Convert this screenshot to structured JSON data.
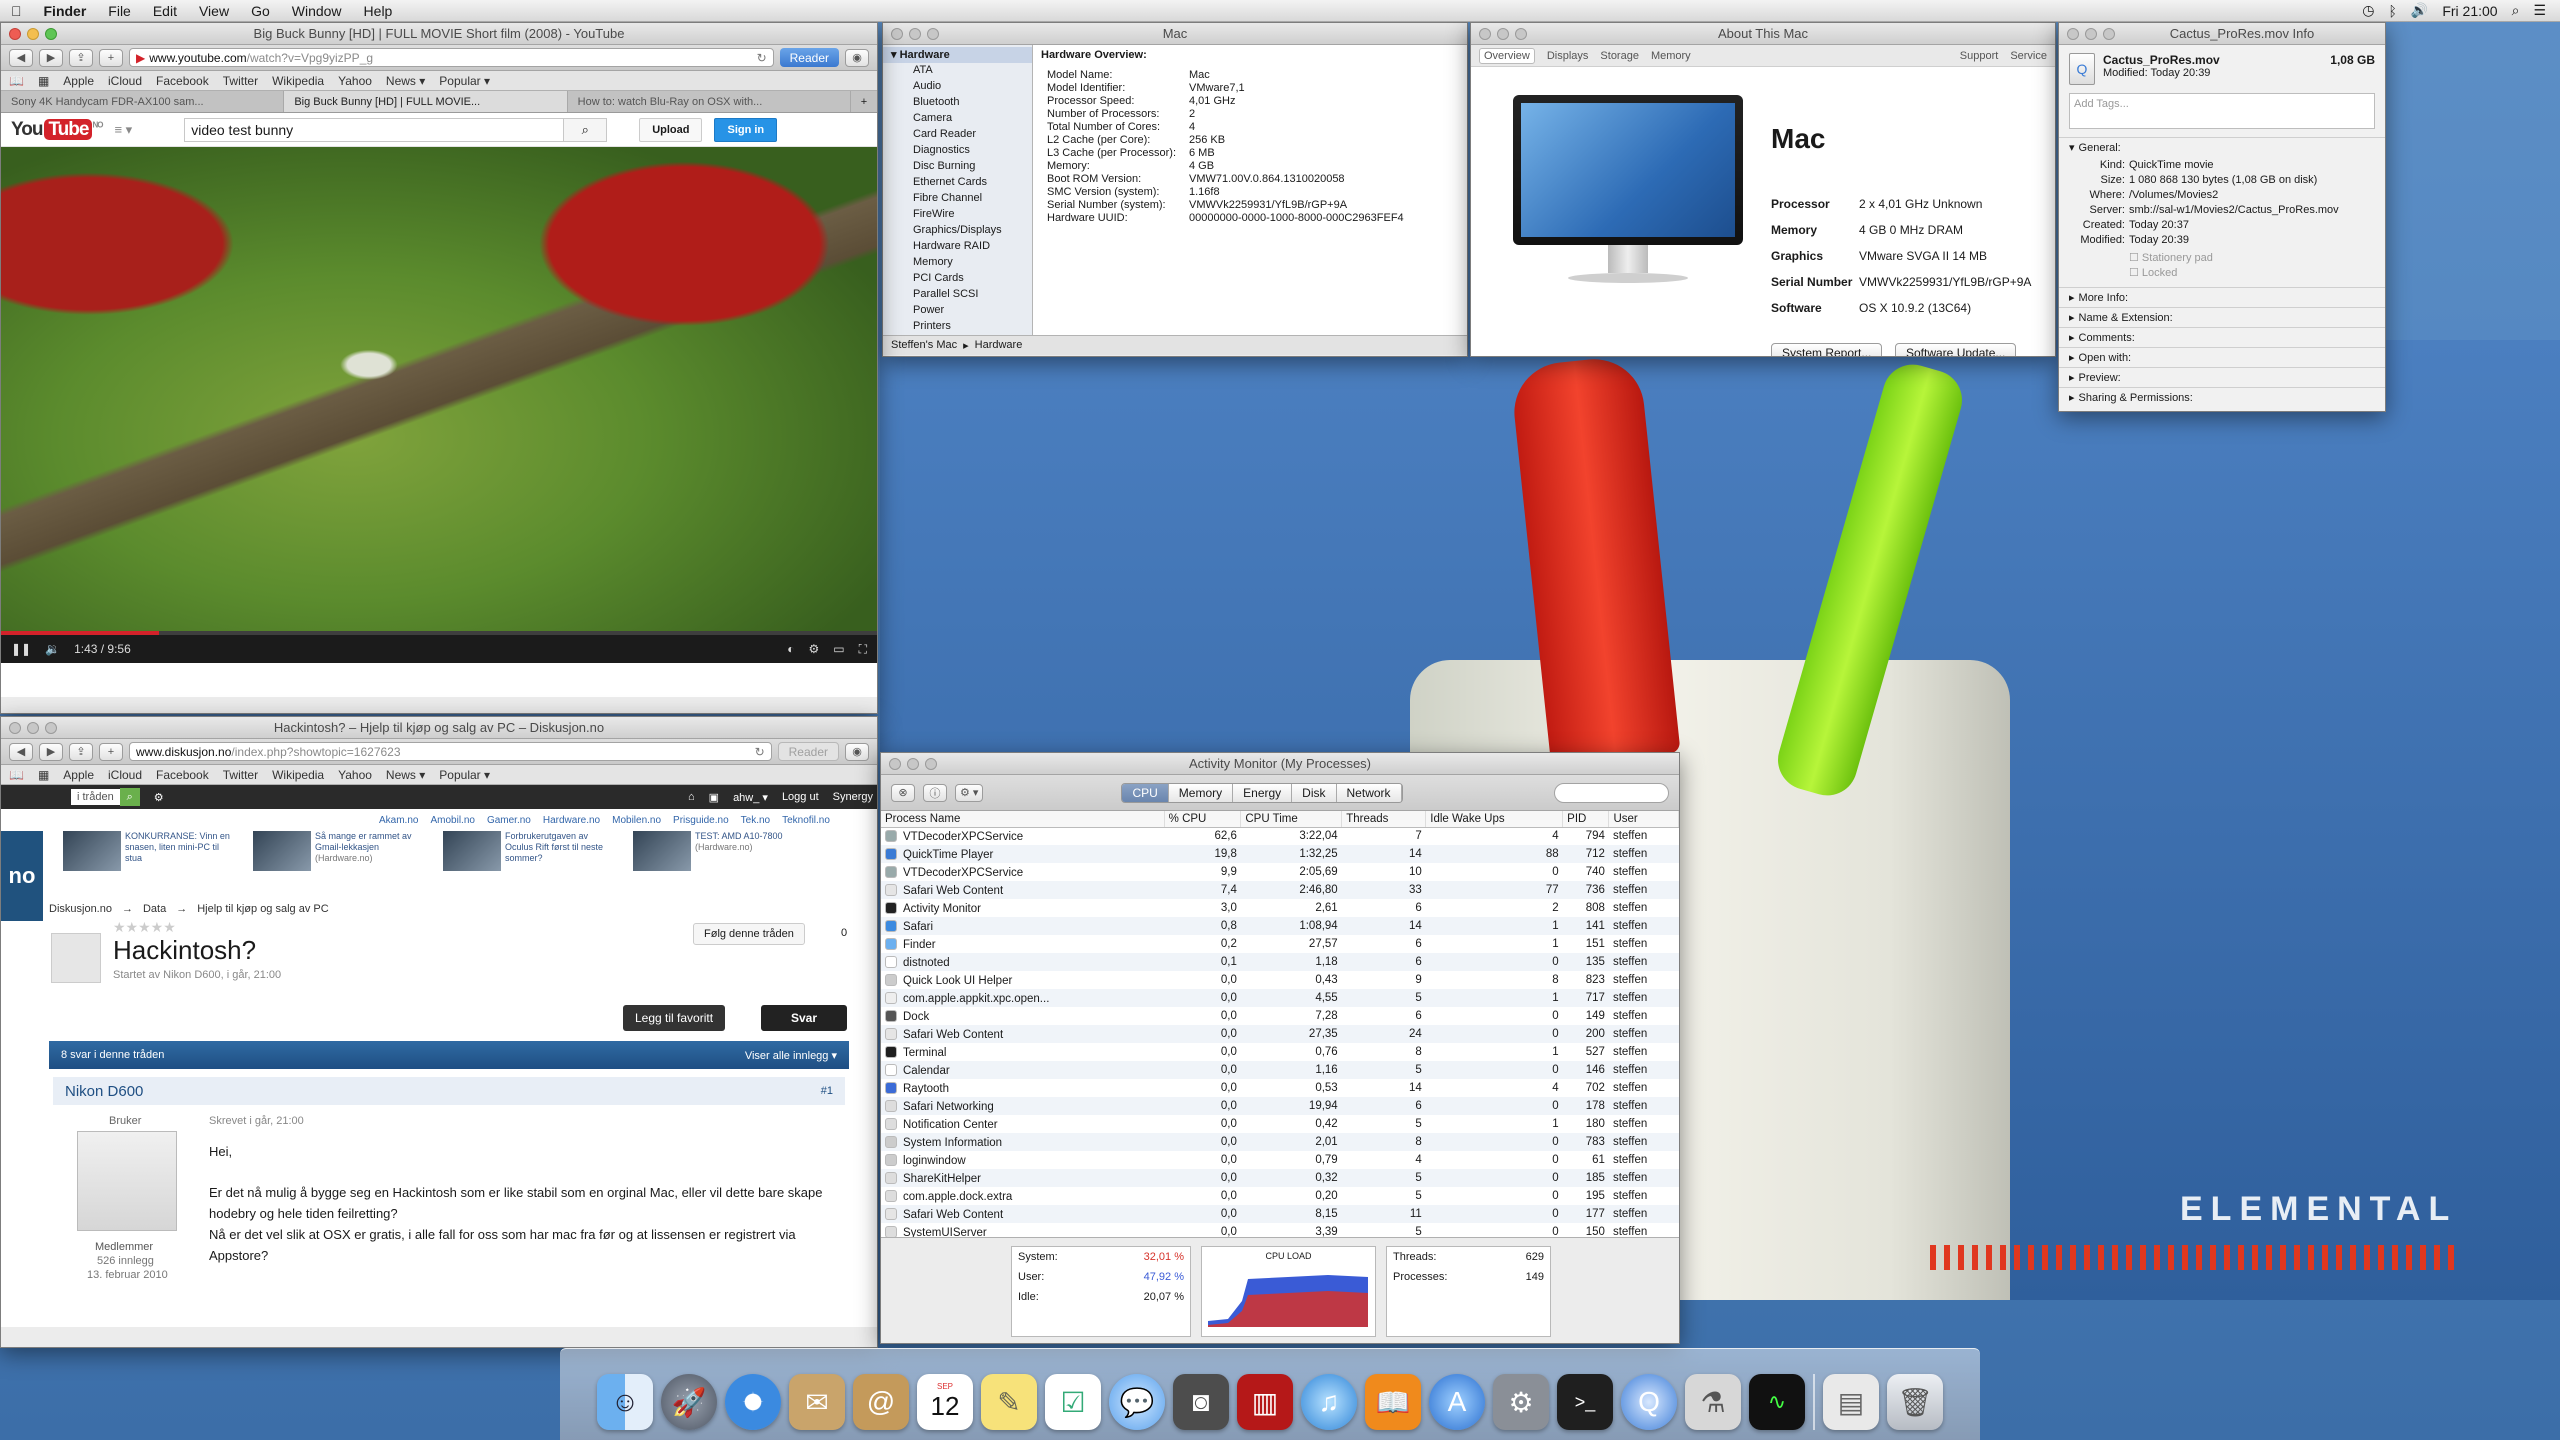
{
  "menubar": {
    "apple": "",
    "app": "Finder",
    "items": [
      "File",
      "Edit",
      "View",
      "Go",
      "Window",
      "Help"
    ],
    "clock": "Fri 21:00"
  },
  "youtube_window": {
    "title": "Big Buck Bunny [HD] | FULL MOVIE Short film (2008) - YouTube",
    "url_host": "www.youtube.com",
    "url_path": "/watch?v=Vpg9yizPP_g",
    "reader": "Reader",
    "bookmarks": [
      "Apple",
      "iCloud",
      "Facebook",
      "Twitter",
      "Wikipedia",
      "Yahoo",
      "News ▾",
      "Popular ▾"
    ],
    "tabs": [
      "Sony 4K Handycam FDR-AX100 sam...",
      "Big Buck Bunny [HD] | FULL MOVIE...",
      "How to: watch Blu-Ray on OSX with..."
    ],
    "logo": "You",
    "logo_tube": "Tube",
    "logo_locale": "NO",
    "search_value": "video test bunny",
    "upload": "Upload",
    "signin": "Sign in",
    "time": "1:43 / 9:56",
    "progress": 0.18
  },
  "diskusjon_window": {
    "title": "Hackintosh? – Hjelp til kjøp og salg av PC – Diskusjon.no",
    "url_host": "www.diskusjon.no",
    "url_path": "/index.php?showtopic=1627623",
    "reader": "Reader",
    "bookmarks": [
      "Apple",
      "iCloud",
      "Facebook",
      "Twitter",
      "Wikipedia",
      "Yahoo",
      "News ▾",
      "Popular ▾"
    ],
    "search_scope": "i tråden",
    "user": "ahw_ ▾",
    "logout": "Logg ut",
    "synergy": "Synergy",
    "sites": [
      "Akam.no",
      "Amobil.no",
      "Gamer.no",
      "Hardware.no",
      "Mobilen.no",
      "Prisguide.no",
      "Tek.no",
      "Teknofil.no"
    ],
    "promos": [
      {
        "text": "KONKURRANSE: Vinn en snasen, liten mini-PC til stua"
      },
      {
        "text": "Så mange er rammet av Gmail-lekkasjen",
        "src": "(Hardware.no)"
      },
      {
        "text": "Forbrukerutgaven av Oculus Rift først til neste sommer?"
      },
      {
        "text": "TEST: AMD A10-7800",
        "src": "(Hardware.no)"
      }
    ],
    "breadcrumb": [
      "Diskusjon.no",
      "→",
      "Data",
      "→",
      "Hjelp til kjøp og salg av PC"
    ],
    "side_tab": "no",
    "follow": "Følg denne tråden",
    "follow_count": "0",
    "thread_title": "Hackintosh?",
    "thread_sub": "Startet av Nikon D600, i går, 21:00",
    "fav": "Legg til favoritt",
    "reply": "Svar",
    "answers": "8 svar i denne tråden",
    "show_all": "Viser alle innlegg ▾",
    "post_author": "Nikon D600",
    "post_num": "#1",
    "role": "Bruker",
    "written": "Skrevet i går, 21:00",
    "member": "Medlemmer",
    "posts": "526 innlegg",
    "joined": "13. februar 2010",
    "body1": "Hei,",
    "body2": "Er det nå mulig å bygge seg en Hackintosh som er like stabil som en orginal Mac, eller vil dette bare skape hodebry og hele tiden feilretting?",
    "body3": "Nå er det vel slik at OSX er gratis, i alle fall for oss som har mac fra før og at lissensen er registrert via Appstore?"
  },
  "sysinfo_window": {
    "title": "Mac",
    "sidebar_header": "Hardware",
    "sidebar": [
      "ATA",
      "Audio",
      "Bluetooth",
      "Camera",
      "Card Reader",
      "Diagnostics",
      "Disc Burning",
      "Ethernet Cards",
      "Fibre Channel",
      "FireWire",
      "Graphics/Displays",
      "Hardware RAID",
      "Memory",
      "PCI Cards",
      "Parallel SCSI",
      "Power",
      "Printers"
    ],
    "overview_title": "Hardware Overview:",
    "rows": [
      [
        "Model Name:",
        "Mac"
      ],
      [
        "Model Identifier:",
        "VMware7,1"
      ],
      [
        "Processor Speed:",
        "4,01 GHz"
      ],
      [
        "Number of Processors:",
        "2"
      ],
      [
        "Total Number of Cores:",
        "4"
      ],
      [
        "L2 Cache (per Core):",
        "256 KB"
      ],
      [
        "L3 Cache (per Processor):",
        "6 MB"
      ],
      [
        "Memory:",
        "4 GB"
      ],
      [
        "Boot ROM Version:",
        "VMW71.00V.0.864.1310020058"
      ],
      [
        "SMC Version (system):",
        "1.16f8"
      ],
      [
        "Serial Number (system):",
        "VMWVk2259931/YfL9B/rGP+9A"
      ],
      [
        "Hardware UUID:",
        "00000000-0000-1000-8000-000C2963FEF4"
      ]
    ],
    "path": [
      "Steffen's Mac",
      "▸",
      "Hardware"
    ]
  },
  "about_window": {
    "title": "About This Mac",
    "tabs": [
      "Overview",
      "Displays",
      "Storage",
      "Memory"
    ],
    "right_tabs": [
      "Support",
      "Service"
    ],
    "name": "Mac",
    "rows": [
      [
        "Processor",
        "2 x 4,01 GHz Unknown"
      ],
      [
        "Memory",
        "4 GB 0 MHz DRAM"
      ],
      [
        "Graphics",
        "VMware SVGA II 14 MB"
      ],
      [
        "Serial Number",
        "VMWVk2259931/YfL9B/rGP+9A"
      ],
      [
        "Software",
        "OS X 10.9.2 (13C64)"
      ]
    ],
    "report": "System Report...",
    "update": "Software Update..."
  },
  "info_window": {
    "title": "Cactus_ProRes.mov Info",
    "file": "Cactus_ProRes.mov",
    "size": "1,08 GB",
    "modified": "Modified: Today 20:39",
    "tags_placeholder": "Add Tags...",
    "general": "General:",
    "kv": [
      [
        "Kind:",
        "QuickTime movie"
      ],
      [
        "Size:",
        "1 080 868 130 bytes (1,08 GB on disk)"
      ],
      [
        "Where:",
        "/Volumes/Movies2"
      ],
      [
        "Server:",
        "smb://sal-w1/Movies2/Cactus_ProRes.mov"
      ],
      [
        "Created:",
        "Today 20:37"
      ],
      [
        "Modified:",
        "Today 20:39"
      ]
    ],
    "stationery": "Stationery pad",
    "locked": "Locked",
    "sections": [
      "More Info:",
      "Name & Extension:",
      "Comments:",
      "Open with:",
      "Preview:",
      "Sharing & Permissions:"
    ]
  },
  "activity_window": {
    "title": "Activity Monitor (My Processes)",
    "tabs": [
      "CPU",
      "Memory",
      "Energy",
      "Disk",
      "Network"
    ],
    "columns": [
      "Process Name",
      "% CPU",
      "CPU Time",
      "Threads",
      "Idle Wake Ups",
      "PID",
      "User"
    ],
    "rows": [
      [
        "VTDecoderXPCService",
        "62,6",
        "3:22,04",
        "7",
        "4",
        "794",
        "steffen"
      ],
      [
        "QuickTime Player",
        "19,8",
        "1:32,25",
        "14",
        "88",
        "712",
        "steffen"
      ],
      [
        "VTDecoderXPCService",
        "9,9",
        "2:05,69",
        "10",
        "0",
        "740",
        "steffen"
      ],
      [
        "Safari Web Content",
        "7,4",
        "2:46,80",
        "33",
        "77",
        "736",
        "steffen"
      ],
      [
        "Activity Monitor",
        "3,0",
        "2,61",
        "6",
        "2",
        "808",
        "steffen"
      ],
      [
        "Safari",
        "0,8",
        "1:08,94",
        "14",
        "1",
        "141",
        "steffen"
      ],
      [
        "Finder",
        "0,2",
        "27,57",
        "6",
        "1",
        "151",
        "steffen"
      ],
      [
        "distnoted",
        "0,1",
        "1,18",
        "6",
        "0",
        "135",
        "steffen"
      ],
      [
        "Quick Look UI Helper",
        "0,0",
        "0,43",
        "9",
        "8",
        "823",
        "steffen"
      ],
      [
        "com.apple.appkit.xpc.open...",
        "0,0",
        "4,55",
        "5",
        "1",
        "717",
        "steffen"
      ],
      [
        "Dock",
        "0,0",
        "7,28",
        "6",
        "0",
        "149",
        "steffen"
      ],
      [
        "Safari Web Content",
        "0,0",
        "27,35",
        "24",
        "0",
        "200",
        "steffen"
      ],
      [
        "Terminal",
        "0,0",
        "0,76",
        "8",
        "1",
        "527",
        "steffen"
      ],
      [
        "Calendar",
        "0,0",
        "1,16",
        "5",
        "0",
        "146",
        "steffen"
      ],
      [
        "Raytooth",
        "0,0",
        "0,53",
        "14",
        "4",
        "702",
        "steffen"
      ],
      [
        "Safari Networking",
        "0,0",
        "19,94",
        "6",
        "0",
        "178",
        "steffen"
      ],
      [
        "Notification Center",
        "0,0",
        "0,42",
        "5",
        "1",
        "180",
        "steffen"
      ],
      [
        "System Information",
        "0,0",
        "2,01",
        "8",
        "0",
        "783",
        "steffen"
      ],
      [
        "loginwindow",
        "0,0",
        "0,79",
        "4",
        "0",
        "61",
        "steffen"
      ],
      [
        "ShareKitHelper",
        "0,0",
        "0,32",
        "5",
        "0",
        "185",
        "steffen"
      ],
      [
        "com.apple.dock.extra",
        "0,0",
        "0,20",
        "5",
        "0",
        "195",
        "steffen"
      ],
      [
        "Safari Web Content",
        "0,0",
        "8,15",
        "11",
        "0",
        "177",
        "steffen"
      ],
      [
        "SystemUIServer",
        "0,0",
        "3,39",
        "5",
        "0",
        "150",
        "steffen"
      ]
    ],
    "system_label": "System:",
    "system": "32,01 %",
    "user_label": "User:",
    "user": "47,92 %",
    "idle_label": "Idle:",
    "idle": "20,07 %",
    "cpu_load": "CPU LOAD",
    "threads_label": "Threads:",
    "threads": "629",
    "processes_label": "Processes:",
    "processes": "149"
  },
  "desktop": {
    "brand": "ELEMENTAL"
  },
  "dock": {
    "calendar_day": "12",
    "calendar_month": "SEP"
  },
  "colors": {
    "youtube_red": "#d3222a",
    "selection_blue": "#3b79d0",
    "cpu_user": "#3a5bd6",
    "cpu_system": "#d6332b"
  }
}
